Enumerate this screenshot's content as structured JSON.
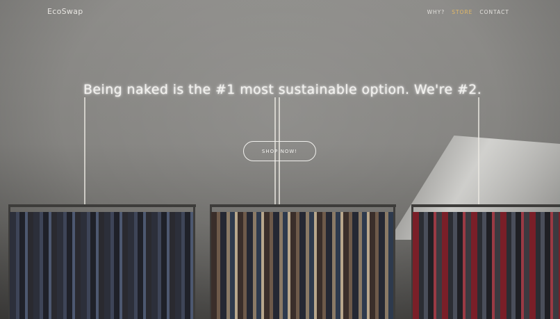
{
  "brand": {
    "name": "EcoSwap"
  },
  "nav": {
    "items": [
      {
        "label": "WHY?",
        "active": false
      },
      {
        "label": "STORE",
        "active": true
      },
      {
        "label": "CONTACT",
        "active": false
      }
    ],
    "active_color": "#e2b866"
  },
  "hero": {
    "neon_text": "Being naked is the #1 most sustainable option. We're #2.",
    "cta_label": "SHOP NOW!"
  }
}
